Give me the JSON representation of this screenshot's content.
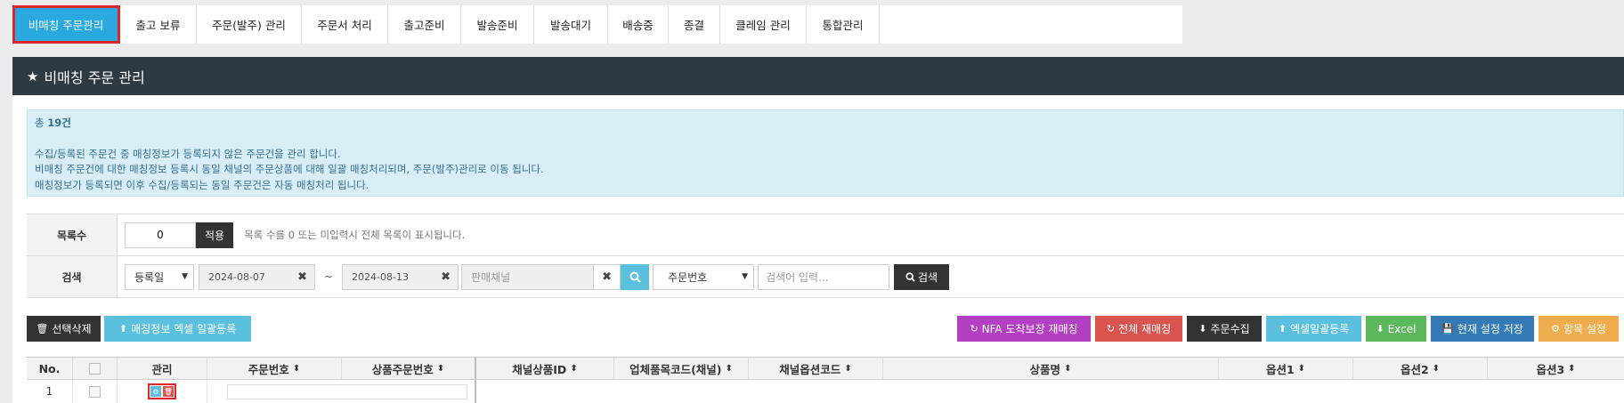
{
  "tabs": [
    {
      "label": "비매칭 주문관리",
      "active": true
    },
    {
      "label": "출고 보류",
      "active": false
    },
    {
      "label": "주문(발주) 관리",
      "active": false
    },
    {
      "label": "주문서 처리",
      "active": false
    },
    {
      "label": "출고준비",
      "active": false
    },
    {
      "label": "발송준비",
      "active": false
    },
    {
      "label": "발송대기",
      "active": false
    },
    {
      "label": "배송중",
      "active": false
    },
    {
      "label": "종결",
      "active": false
    },
    {
      "label": "클레임 관리",
      "active": false
    },
    {
      "label": "통합관리",
      "active": false
    }
  ],
  "panel": {
    "title": "비매칭 주문 관리"
  },
  "info": {
    "count_prefix": "총 ",
    "count_value": "19",
    "count_suffix": "건",
    "lines": [
      "수집/등록된 주문건 중 매칭정보가 등록되지 않은 주문건을 관리 합니다.",
      "비매칭 주문건에 대한 매칭정보 등록시 동일 채널의 주문상품에 대해 일괄 매칭처리되며, 주문(발주)관리로 이동 됩니다.",
      "매칭정보가 등록되면 이후 수집/등록되는 동일 주문건은 자동 매칭처리 됩니다."
    ]
  },
  "form": {
    "list_count": {
      "label": "목록수",
      "value": "0",
      "apply_label": "적용",
      "hint": "목록 수를 0 또는 미입력시 전체 목록이 표시됩니다."
    },
    "search": {
      "label": "검색",
      "date_type": "등록일",
      "date_from": "2024-08-07",
      "tilde": "~",
      "date_to": "2024-08-13",
      "channel_placeholder": "판매채널",
      "field_type": "주문번호",
      "keyword_placeholder": "검색어 입력...",
      "search_label": "검색"
    }
  },
  "actions": {
    "delete_selected": "선택삭제",
    "bulk_match_excel": "매칭정보 엑셀 일괄등록",
    "nfa_rematch": "NFA 도착보장 재매칭",
    "all_rematch": "전체 재매칭",
    "collect_orders": "주문수집",
    "excel_bulk_register": "엑셀일괄등록",
    "excel": "Excel",
    "save_settings": "현재 설정 저장",
    "column_settings": "항목 설정"
  },
  "colors": {
    "tab_active": "#29a9df",
    "header": "#2d3a42",
    "purple": "#b340c3",
    "red": "#d9534f",
    "dark": "#333333",
    "info": "#5bc0de",
    "green": "#5cb85c",
    "blue": "#337ab7",
    "orange": "#f0ad4e"
  },
  "table": {
    "columns": [
      "No.",
      "",
      "관리",
      "주문번호",
      "상품주문번호",
      "채널상품ID",
      "업체품목코드(채널)",
      "채널옵션코드",
      "상품명",
      "옵션1",
      "옵션2",
      "옵션3"
    ],
    "rows": [
      {
        "no": "1"
      }
    ]
  }
}
